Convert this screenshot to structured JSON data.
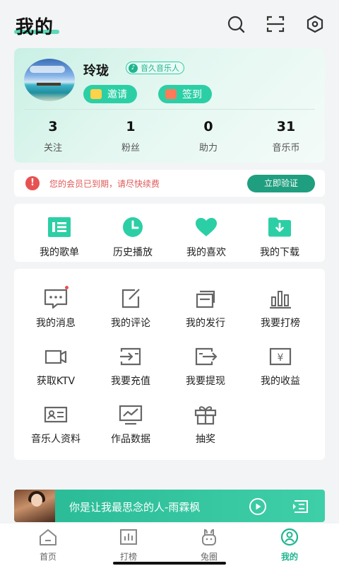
{
  "header": {
    "title": "我的"
  },
  "profile": {
    "username": "玲珑",
    "badge": "音久音乐人",
    "invite_label": "邀请",
    "checkin_label": "签到",
    "stats": [
      {
        "value": "3",
        "label": "关注"
      },
      {
        "value": "1",
        "label": "粉丝"
      },
      {
        "value": "0",
        "label": "助力"
      },
      {
        "value": "31",
        "label": "音乐币"
      }
    ]
  },
  "notice": {
    "icon_text": "!",
    "text": "您的会员已到期，请尽快续费",
    "button": "立即验证"
  },
  "quick": [
    {
      "label": "我的歌单",
      "icon": "playlist-icon"
    },
    {
      "label": "历史播放",
      "icon": "clock-icon"
    },
    {
      "label": "我的喜欢",
      "icon": "heart-icon"
    },
    {
      "label": "我的下载",
      "icon": "download-folder-icon"
    }
  ],
  "grid": [
    {
      "label": "我的消息",
      "icon": "message-icon"
    },
    {
      "label": "我的评论",
      "icon": "edit-icon"
    },
    {
      "label": "我的发行",
      "icon": "release-icon"
    },
    {
      "label": "我要打榜",
      "icon": "chart-icon"
    },
    {
      "label": "获取KTV",
      "icon": "video-camera-icon"
    },
    {
      "label": "我要充值",
      "icon": "recharge-icon"
    },
    {
      "label": "我要提现",
      "icon": "withdraw-icon"
    },
    {
      "label": "我的收益",
      "icon": "yen-icon"
    },
    {
      "label": "音乐人资料",
      "icon": "id-card-icon"
    },
    {
      "label": "作品数据",
      "icon": "monitor-chart-icon"
    },
    {
      "label": "抽奖",
      "icon": "gift-icon"
    }
  ],
  "player": {
    "title": "你是让我最思念的人-雨霖枫"
  },
  "tabs": [
    {
      "label": "首页",
      "icon": "home-icon"
    },
    {
      "label": "打榜",
      "icon": "chart-icon"
    },
    {
      "label": "兔圈",
      "icon": "rabbit-icon"
    },
    {
      "label": "我的",
      "icon": "user-icon",
      "active": true
    }
  ],
  "colors": {
    "accent": "#2ccfa5",
    "accent_dark": "#1f9f7f",
    "warning": "#e85151"
  }
}
